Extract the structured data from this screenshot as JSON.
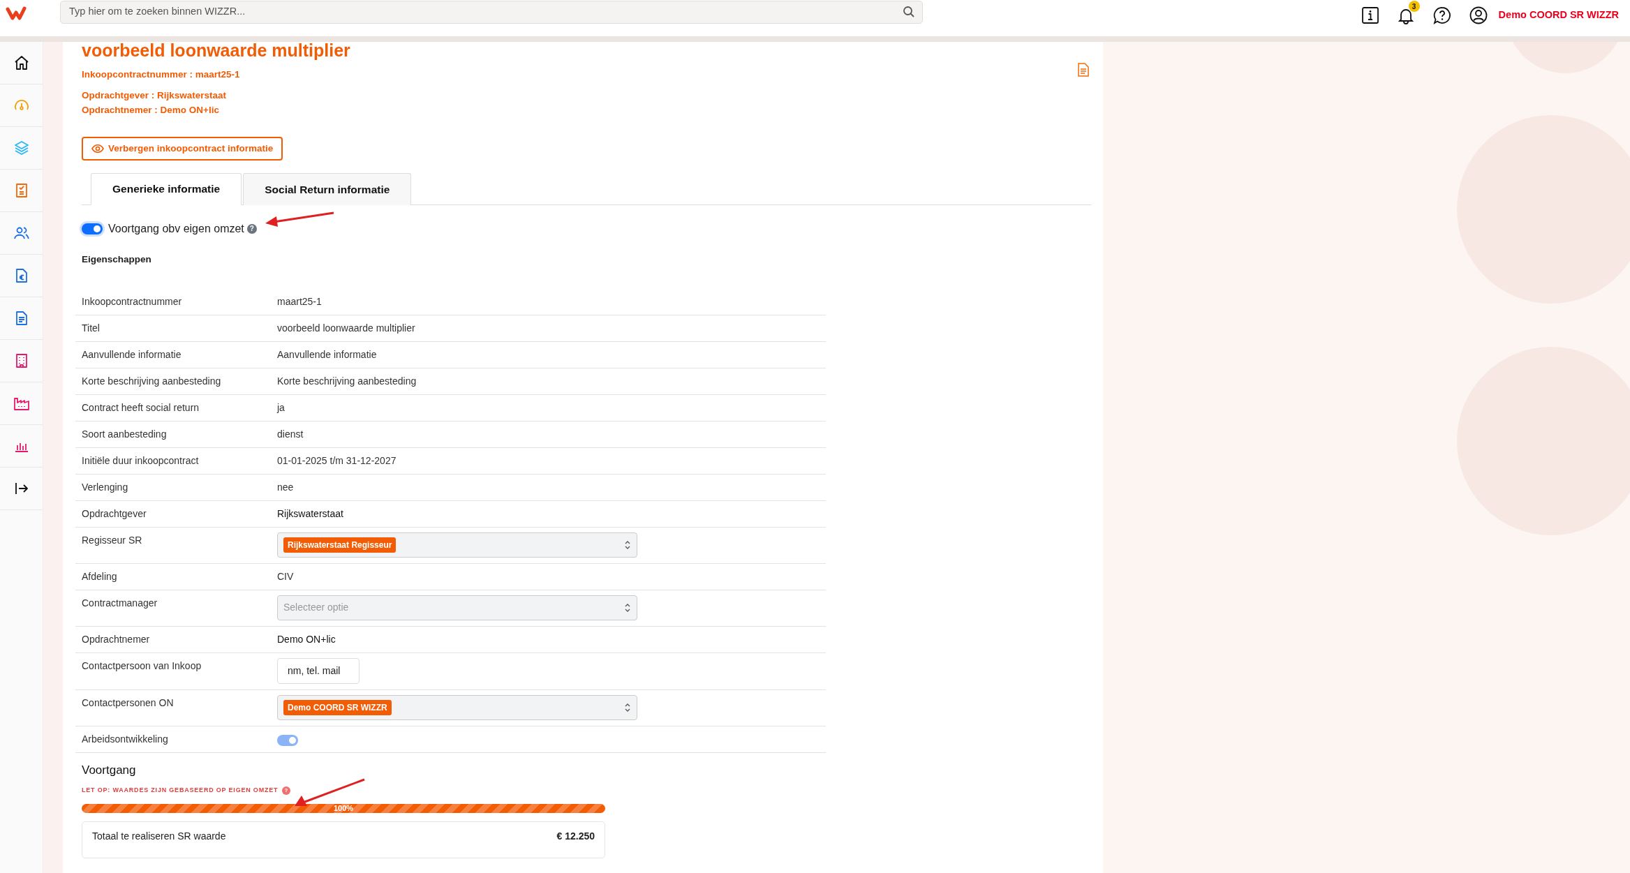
{
  "topbar": {
    "search": {
      "placeholder": "Typ hier om te zoeken binnen WIZZR..."
    },
    "notification_count": "3",
    "user": "Demo COORD SR WIZZR"
  },
  "sidebar": {
    "items": [
      {
        "kind": "home",
        "color": "#111111"
      },
      {
        "kind": "gauge",
        "color": "#f5a000"
      },
      {
        "kind": "layers",
        "color": "#29b6f6"
      },
      {
        "kind": "checklist",
        "color": "#f26b0a"
      },
      {
        "kind": "users",
        "color": "#1e6fe0"
      },
      {
        "kind": "euro-doc",
        "color": "#1e6fe0"
      },
      {
        "kind": "doc",
        "color": "#1e6fe0"
      },
      {
        "kind": "building",
        "color": "#e6186e"
      },
      {
        "kind": "factory",
        "color": "#e6186e"
      },
      {
        "kind": "chart",
        "color": "#e6186e"
      },
      {
        "kind": "logout",
        "color": "#111111"
      }
    ]
  },
  "contract": {
    "title": "voorbeeld loonwaarde multiplier",
    "details": [
      "Inkoopcontractnummer : maart25-1",
      "Opdrachtgever : Rijkswaterstaat",
      "Opdrachtnemer : Demo ON+lic"
    ],
    "hide_button": "Verbergen inkoopcontract informatie"
  },
  "tabs": [
    {
      "label": "Generieke informatie",
      "selected": true
    },
    {
      "label": "Social Return informatie",
      "selected": false
    }
  ],
  "own_revenue_switch": {
    "label": "Voortgang obv eigen omzet",
    "on": true,
    "help_icon": "?"
  },
  "properties": {
    "title": "Eigenschappen",
    "rows": [
      {
        "label": "Inkoopcontractnummer",
        "kind": "text",
        "value": "maart25-1"
      },
      {
        "label": "Titel",
        "kind": "text",
        "value": "voorbeeld loonwaarde multiplier"
      },
      {
        "label": "Aanvullende informatie",
        "kind": "text",
        "value": "Aanvullende informatie"
      },
      {
        "label": "Korte beschrijving aanbesteding",
        "kind": "text",
        "value": "Korte beschrijving aanbesteding"
      },
      {
        "label": "Contract heeft social return",
        "kind": "text",
        "value": "ja"
      },
      {
        "label": "Soort aanbesteding",
        "kind": "text",
        "value": "dienst"
      },
      {
        "label": "Initiële duur inkoopcontract",
        "kind": "text",
        "value": "01-01-2025 t/m 31-12-2027"
      },
      {
        "label": "Verlenging",
        "kind": "text",
        "value": "nee"
      },
      {
        "label": "Opdrachtgever",
        "kind": "link",
        "value": "Rijkswaterstaat"
      },
      {
        "label": "Regisseur SR",
        "kind": "tag-select",
        "value": "Rijkswaterstaat Regisseur"
      },
      {
        "label": "Afdeling",
        "kind": "text",
        "value": "CIV"
      },
      {
        "label": "Contractmanager",
        "kind": "select",
        "placeholder": "Selecteer optie"
      },
      {
        "label": "Opdrachtnemer",
        "kind": "link",
        "value": "Demo ON+lic"
      },
      {
        "label": "Contactpersoon van Inkoop",
        "kind": "input",
        "value": "nm, tel. mail"
      },
      {
        "label": "Contactpersonen ON",
        "kind": "tag-select",
        "value": "Demo COORD SR WIZZR"
      },
      {
        "label": "Arbeidsontwikkeling",
        "kind": "switch",
        "on": true,
        "disabled": true
      }
    ]
  },
  "progress": {
    "title": "Voortgang",
    "warning": "LET OP: WAARDES ZIJN GEBASEERD OP EIGEN OMZET",
    "help_icon": "?",
    "level": 1.0,
    "label": "100%",
    "total": {
      "label": "Totaal te realiseren SR waarde",
      "value": "€ 12.250"
    }
  }
}
